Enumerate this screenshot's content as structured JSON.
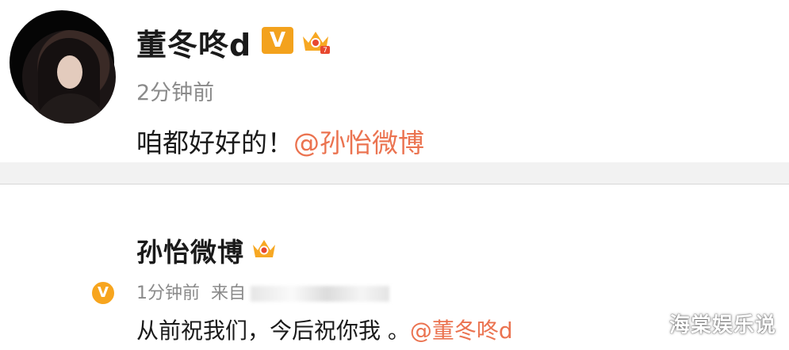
{
  "comments": [
    {
      "author": "董冬咚d",
      "verified_badge": "V",
      "time": "2分钟前",
      "text": "咱都好好的！",
      "mention": "@孙怡微博"
    },
    {
      "author": "孙怡微博",
      "verified_badge": "V",
      "time": "1分钟前",
      "source_prefix": "来自",
      "text": "从前祝我们，今后祝你我 。",
      "mention": "@董冬咚d"
    }
  ],
  "watermark": "海棠娱乐说",
  "colors": {
    "mention": "#eb7350",
    "badge": "#f3a21d",
    "meta": "#8a8a8a"
  },
  "icons": [
    "verified-v-icon",
    "crown-level-icon"
  ]
}
